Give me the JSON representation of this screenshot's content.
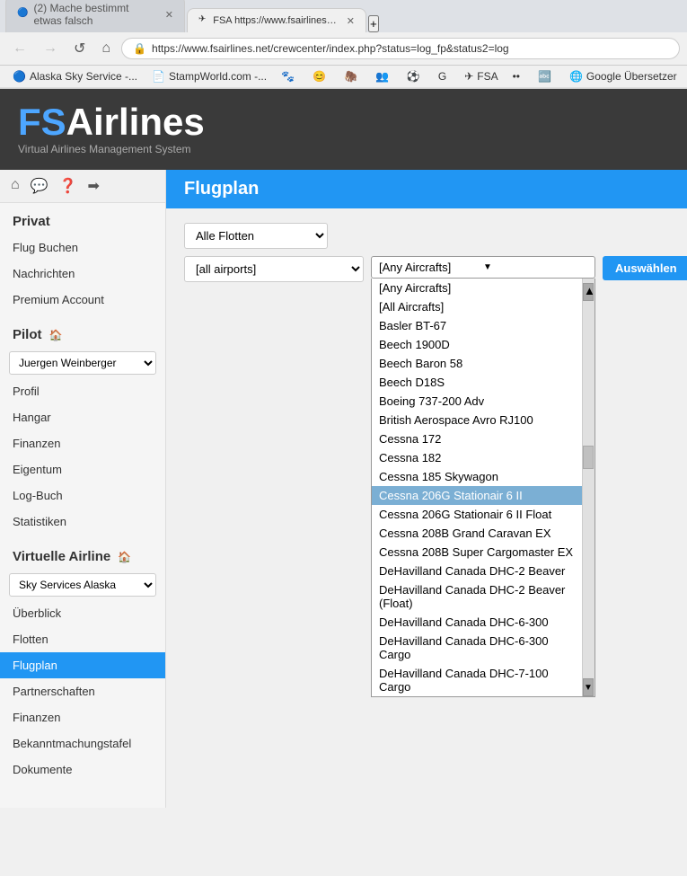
{
  "browser": {
    "tabs": [
      {
        "id": "tab1",
        "title": "(2) Mache bestimmt etwas falsch",
        "active": false,
        "favicon": "🔵"
      },
      {
        "id": "tab2",
        "title": "FSA  https://www.fsairlines.net/crewce...",
        "active": true,
        "favicon": "✈"
      }
    ],
    "new_tab_label": "+",
    "nav": {
      "back": "←",
      "forward": "→",
      "refresh": "↺",
      "home": "⌂"
    },
    "address": "https://www.fsairlines.net/crewcenter/index.php?status=log_fp&status2=log",
    "bookmarks": [
      {
        "label": "Alaska Sky Service -...",
        "icon": "🔵"
      },
      {
        "label": "StampWorld.com -...",
        "icon": "📄"
      },
      {
        "label": "",
        "icon": "🐾"
      },
      {
        "label": "",
        "icon": "😊"
      },
      {
        "label": "",
        "icon": "🦣"
      },
      {
        "label": "",
        "icon": "👥"
      },
      {
        "label": "",
        "icon": "⚽"
      },
      {
        "label": "",
        "icon": "G"
      },
      {
        "label": "FSA",
        "icon": "✈"
      },
      {
        "label": "",
        "icon": "••"
      },
      {
        "label": "",
        "icon": "🔤"
      },
      {
        "label": "Google Übersetzer",
        "icon": "🌐"
      },
      {
        "label": "",
        "icon": "☀"
      }
    ]
  },
  "site": {
    "logo_fs": "FS",
    "logo_airlines": "Airlines",
    "tagline": "Virtual Airlines Management System"
  },
  "sidebar": {
    "icons": [
      "⌂",
      "💬",
      "❓",
      "➡"
    ],
    "privat": {
      "title": "Privat",
      "items": [
        "Flug Buchen",
        "Nachrichten",
        "Premium Account"
      ]
    },
    "pilot": {
      "title": "Pilot",
      "pilot_name": "Juergen Weinberger",
      "items": [
        "Profil",
        "Hangar",
        "Finanzen",
        "Eigentum",
        "Log-Buch",
        "Statistiken"
      ]
    },
    "virtual_airline": {
      "title": "Virtuelle Airline",
      "airline_name": "Sky Services Alaska",
      "items": [
        "Überblick",
        "Flotten",
        "Flugplan",
        "Partnerschaften",
        "Finanzen",
        "Bekanntmachungstafel",
        "Dokumente"
      ]
    }
  },
  "content": {
    "title": "Flugplan",
    "filters": {
      "fleet_label": "Alle Flotten",
      "airport_label": "[all airports]",
      "aircraft_label": "[Any Aircrafts]"
    },
    "button_label": "Auswählen",
    "aircraft_options": [
      {
        "value": "[Any Aircrafts]",
        "label": "[Any Aircrafts]",
        "selected": false
      },
      {
        "value": "[All Aircrafts]",
        "label": "[All Aircrafts]",
        "selected": false
      },
      {
        "value": "Basler BT-67",
        "label": "Basler BT-67",
        "selected": false
      },
      {
        "value": "Beech 1900D",
        "label": "Beech 1900D",
        "selected": false
      },
      {
        "value": "Beech Baron 58",
        "label": "Beech Baron 58",
        "selected": false
      },
      {
        "value": "Beech D18S",
        "label": "Beech D18S",
        "selected": false
      },
      {
        "value": "Boeing 737-200 Adv",
        "label": "Boeing 737-200 Adv",
        "selected": false
      },
      {
        "value": "British Aerospace Avro RJ100",
        "label": "British Aerospace Avro RJ100",
        "selected": false
      },
      {
        "value": "Cessna 172",
        "label": "Cessna 172",
        "selected": false
      },
      {
        "value": "Cessna 182",
        "label": "Cessna 182",
        "selected": false
      },
      {
        "value": "Cessna 185 Skywagon",
        "label": "Cessna 185 Skywagon",
        "selected": false
      },
      {
        "value": "Cessna 206G Stationair 6 II",
        "label": "Cessna 206G Stationair 6 II",
        "selected": true
      },
      {
        "value": "Cessna 206G Stationair 6 II Float",
        "label": "Cessna 206G Stationair 6 II Float",
        "selected": false
      },
      {
        "value": "Cessna 208B Grand Caravan EX",
        "label": "Cessna 208B Grand Caravan EX",
        "selected": false
      },
      {
        "value": "Cessna 208B Super Cargomaster EX",
        "label": "Cessna 208B Super Cargomaster EX",
        "selected": false
      },
      {
        "value": "DeHavilland Canada DHC-2 Beaver",
        "label": "DeHavilland Canada DHC-2 Beaver",
        "selected": false
      },
      {
        "value": "DeHavilland Canada DHC-2 Beaver (Float)",
        "label": "DeHavilland Canada DHC-2 Beaver (Float)",
        "selected": false
      },
      {
        "value": "DeHavilland Canada DHC-6-300",
        "label": "DeHavilland Canada DHC-6-300",
        "selected": false
      },
      {
        "value": "DeHavilland Canada DHC-6-300 Cargo",
        "label": "DeHavilland Canada DHC-6-300 Cargo",
        "selected": false
      },
      {
        "value": "DeHavilland Canada DHC-7-100 Cargo",
        "label": "DeHavilland Canada DHC-7-100 Cargo",
        "selected": false
      }
    ]
  }
}
